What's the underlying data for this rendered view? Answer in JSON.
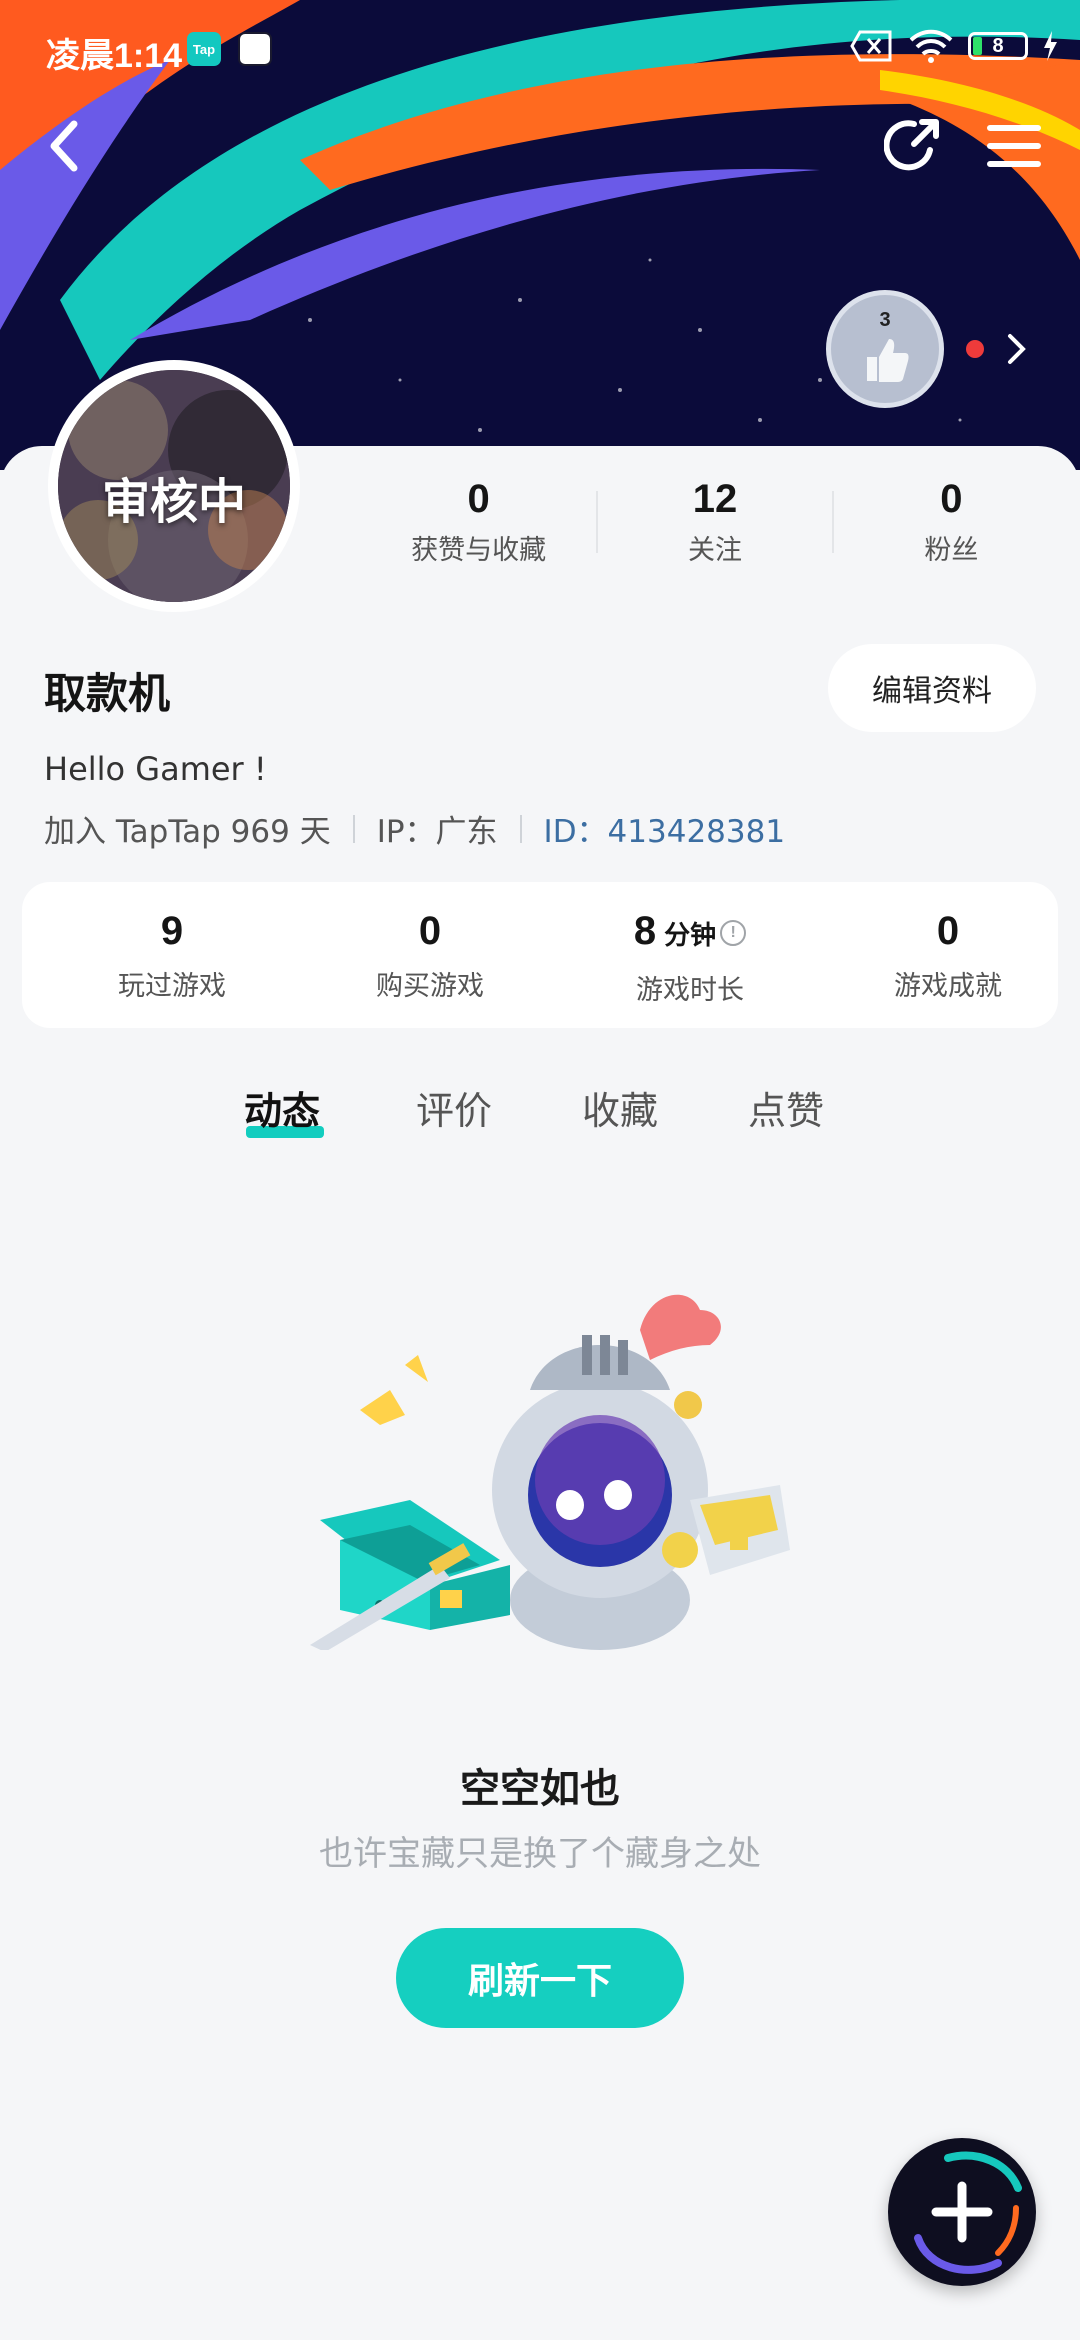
{
  "status_bar": {
    "time": "凌晨1:14",
    "app_badge": "Tap",
    "battery": "8"
  },
  "badge": {
    "level": "3"
  },
  "avatar": {
    "label": "审核中"
  },
  "stats": [
    {
      "value": "0",
      "label": "获赞与收藏"
    },
    {
      "value": "12",
      "label": "关注"
    },
    {
      "value": "0",
      "label": "粉丝"
    }
  ],
  "profile": {
    "username": "取款机",
    "edit_label": "编辑资料",
    "bio": "Hello Gamer !",
    "joined": "加入 TapTap 969 天",
    "ip": "IP：广东",
    "id": "ID：413428381"
  },
  "game_stats": [
    {
      "value": "9",
      "unit": "",
      "label": "玩过游戏"
    },
    {
      "value": "0",
      "unit": "",
      "label": "购买游戏"
    },
    {
      "value": "8",
      "unit": "分钟",
      "label": "游戏时长"
    },
    {
      "value": "0",
      "unit": "",
      "label": "游戏成就"
    }
  ],
  "tabs": [
    "动态",
    "评价",
    "收藏",
    "点赞"
  ],
  "empty_state": {
    "title": "空空如也",
    "subtitle": "也许宝藏只是换了个藏身之处",
    "button": "刷新一下"
  },
  "colors": {
    "accent": "#15cfc0",
    "id_link": "#3c6ea2",
    "banner_bg": "#0b0b3a"
  }
}
